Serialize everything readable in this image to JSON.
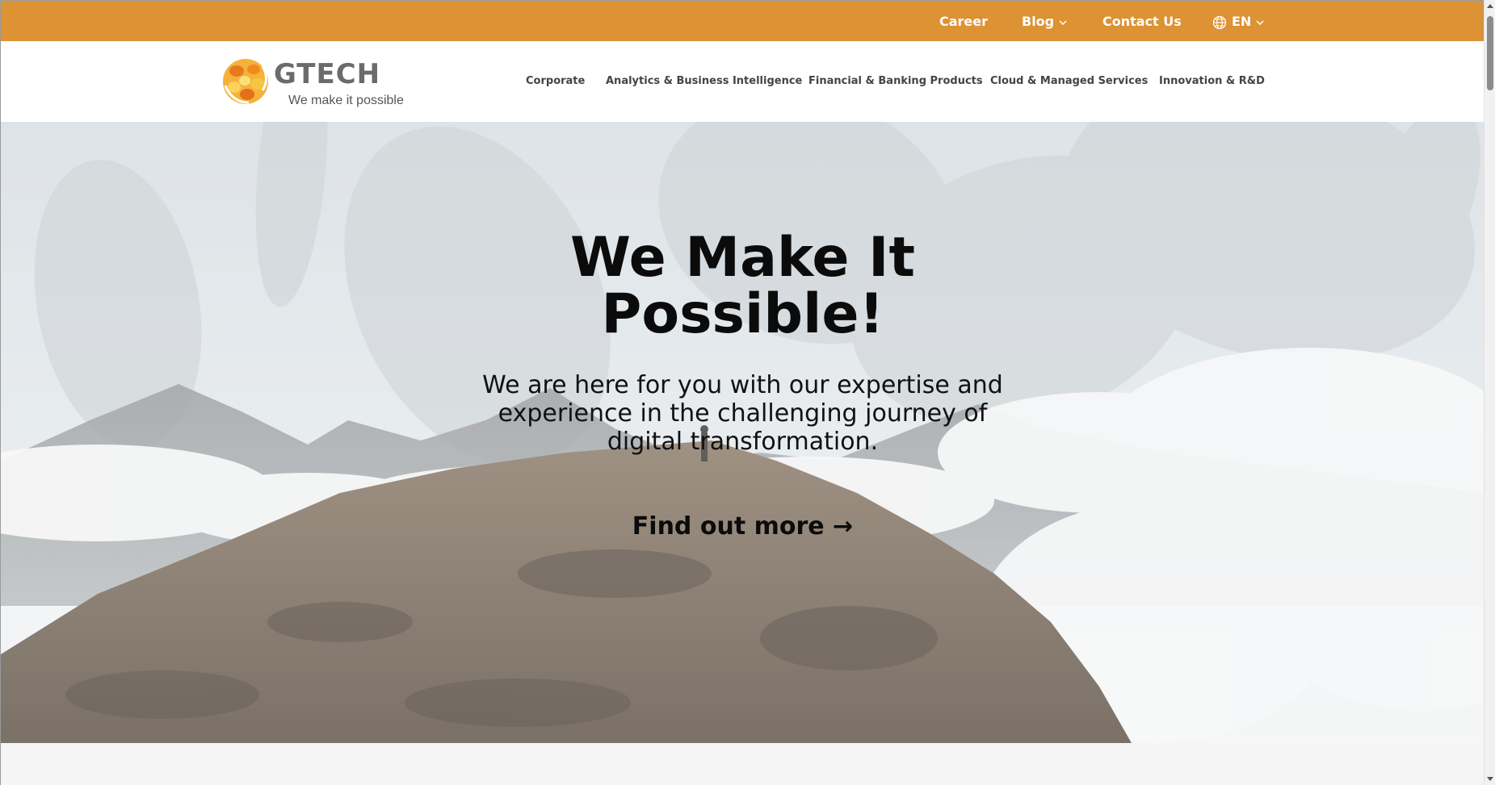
{
  "topbar": {
    "career": "Career",
    "blog": "Blog",
    "contact": "Contact Us",
    "language": "EN",
    "bg_color": "#dd9233"
  },
  "logo": {
    "word": "GTECH",
    "tagline": "We make it possible"
  },
  "nav": {
    "items": [
      "Corporate",
      "Analytics & Business Intelligence",
      "Financial & Banking Products",
      "Cloud & Managed Services",
      "Innovation & R&D"
    ]
  },
  "hero": {
    "title_line1": "We Make It",
    "title_line2": "Possible!",
    "subtitle": "We are here for you with our expertise and experience in the challenging journey of digital transformation.",
    "cta": "Find out more →"
  },
  "icons": {
    "globe": "globe-icon",
    "chevron": "chevron-down-icon"
  }
}
